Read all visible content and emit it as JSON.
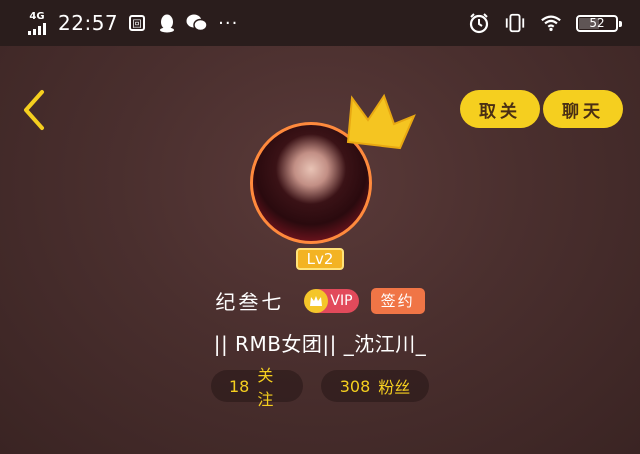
{
  "status_bar": {
    "network": "4G",
    "time": "22:57",
    "more": "···",
    "battery_level": "52",
    "battery_fraction": 0.52
  },
  "header": {
    "back_icon": "chevron-left-icon",
    "unfollow_label": "取关",
    "chat_label": "聊天"
  },
  "profile": {
    "level": "Lv2",
    "username": "纪叁七",
    "vip_label": "VIP",
    "signed_label": "签约",
    "bio": "|| RMB女团|| _沈江川_",
    "following_count": "18",
    "following_label": "关注",
    "fans_count": "308",
    "fans_label": "粉丝"
  },
  "colors": {
    "accent_yellow": "#f5cf1f",
    "avatar_ring": "#ff8a3d",
    "vip_badge": "#e24a5b",
    "signed_badge": "#f07546",
    "background": "#4a2f2e"
  }
}
